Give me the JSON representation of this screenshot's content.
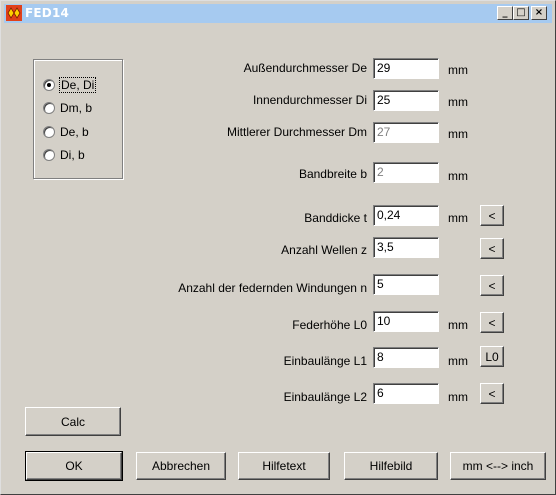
{
  "window": {
    "title": "FED14",
    "minimize": "_",
    "maximize": "□",
    "close": "×"
  },
  "mode_group": {
    "options": [
      {
        "label": "De, Di",
        "selected": true
      },
      {
        "label": "Dm, b",
        "selected": false
      },
      {
        "label": "De, b",
        "selected": false
      },
      {
        "label": "Di, b",
        "selected": false
      }
    ]
  },
  "fields": [
    {
      "label": "Außendurchmesser De",
      "value": "29",
      "unit": "mm",
      "disabled": false,
      "button": ""
    },
    {
      "label": "Innendurchmesser Di",
      "value": "25",
      "unit": "mm",
      "disabled": false,
      "button": ""
    },
    {
      "label": "Mittlerer Durchmesser Dm",
      "value": "27",
      "unit": "mm",
      "disabled": true,
      "button": ""
    },
    {
      "label": "Bandbreite b",
      "value": "2",
      "unit": "mm",
      "disabled": true,
      "button": ""
    },
    {
      "label": "Banddicke t",
      "value": "0,24",
      "unit": "mm",
      "disabled": false,
      "button": "<"
    },
    {
      "label": "Anzahl Wellen z",
      "value": "3,5",
      "unit": "",
      "disabled": false,
      "button": "<"
    },
    {
      "label": "Anzahl der federnden Windungen n",
      "value": "5",
      "unit": "",
      "disabled": false,
      "button": "<"
    },
    {
      "label": "Federhöhe L0",
      "value": "10",
      "unit": "mm",
      "disabled": false,
      "button": "<"
    },
    {
      "label": "Einbaulänge L1",
      "value": "8",
      "unit": "mm",
      "disabled": false,
      "button": "L0"
    },
    {
      "label": "Einbaulänge L2",
      "value": "6",
      "unit": "mm",
      "disabled": false,
      "button": "<"
    }
  ],
  "buttons": {
    "calc": "Calc",
    "ok": "OK",
    "cancel": "Abbrechen",
    "helptext": "Hilfetext",
    "helpimage": "Hilfebild",
    "units": "mm <--> inch"
  }
}
